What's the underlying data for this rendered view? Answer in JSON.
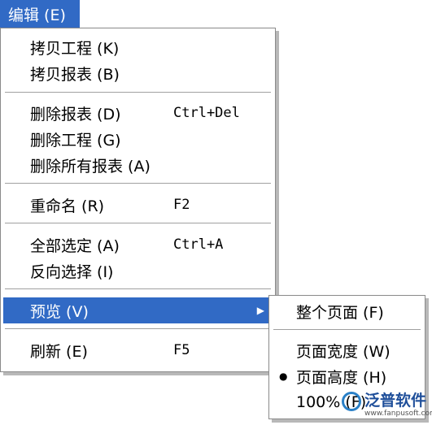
{
  "menubar": {
    "edit_label": "编辑 (E)"
  },
  "main_menu": {
    "items": [
      {
        "label": "拷贝工程 (K)",
        "shortcut": ""
      },
      {
        "label": "拷贝报表 (B)",
        "shortcut": ""
      },
      {
        "label": "删除报表 (D)",
        "shortcut": "Ctrl+Del"
      },
      {
        "label": "删除工程 (G)",
        "shortcut": ""
      },
      {
        "label": "删除所有报表 (A)",
        "shortcut": ""
      },
      {
        "label": "重命名 (R)",
        "shortcut": "F2"
      },
      {
        "label": "全部选定 (A)",
        "shortcut": "Ctrl+A"
      },
      {
        "label": "反向选择 (I)",
        "shortcut": ""
      },
      {
        "label": "预览 (V)",
        "shortcut": "",
        "submenu": true,
        "selected": true
      },
      {
        "label": "刷新 (E)",
        "shortcut": "F5"
      }
    ]
  },
  "preview_submenu": {
    "items": [
      {
        "label": "整个页面 (F)",
        "checked": false
      },
      {
        "label": "页面宽度 (W)",
        "checked": false
      },
      {
        "label": "页面高度 (H)",
        "checked": true
      },
      {
        "label": "100% (F)",
        "checked": false
      }
    ]
  },
  "watermark": {
    "text": "泛普软件",
    "url": "www.fanpusoft.com"
  },
  "colors": {
    "highlight": "#316ac5",
    "highlight_text": "#ffffff",
    "border": "#8a8a8a"
  }
}
